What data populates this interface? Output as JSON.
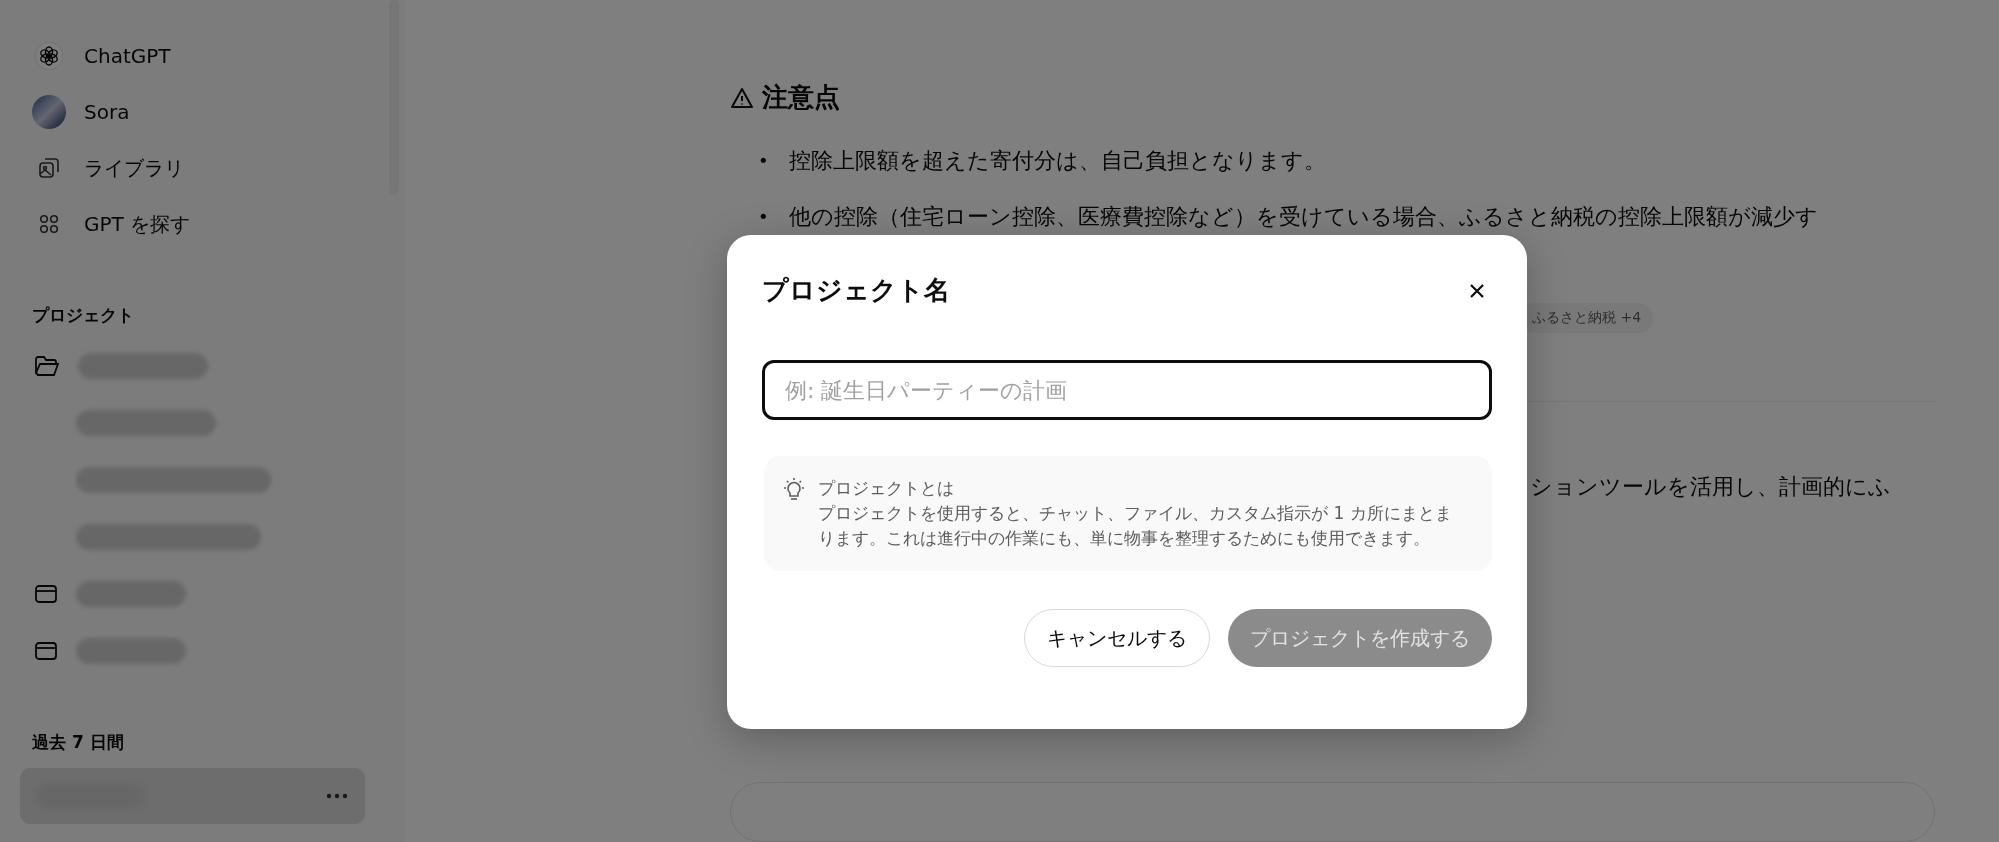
{
  "sidebar": {
    "nav": [
      {
        "label": "ChatGPT",
        "kind": "logo"
      },
      {
        "label": "Sora",
        "kind": "avatar"
      },
      {
        "label": "ライブラリ",
        "kind": "library"
      },
      {
        "label": "GPT を探す",
        "kind": "explore"
      }
    ],
    "projects_heading": "プロジェクト",
    "projects": [
      {
        "expanded": true,
        "children": [
          {
            "kind": "chat"
          },
          {
            "kind": "chat"
          },
          {
            "kind": "chat"
          }
        ]
      },
      {
        "expanded": false
      },
      {
        "expanded": false
      }
    ],
    "recent_heading": "過去 7 日間",
    "recent": [
      {
        "selected": true
      }
    ]
  },
  "main": {
    "heading": "注意点",
    "bullets": [
      {
        "marker": "•",
        "text": "控除上限額を超えた寄付分は、自己負担となります。"
      },
      {
        "marker": "•",
        "text": "他の控除（住宅ローン控除、医療費控除など）を受けている場合、ふるさと納税の控除上限額が減少す"
      }
    ],
    "tag": "ふるさと納税 +4",
    "fragment": "ションツールを活用し、計画的にふ"
  },
  "dialog": {
    "title": "プロジェクト名",
    "placeholder": "例: 誕生日パーティーの計画",
    "info_title": "プロジェクトとは",
    "info_text": "プロジェクトを使用すると、チャット、ファイル、カスタム指示が 1 カ所にまとまります。これは進行中の作業にも、単に物事を整理するためにも使用できます。",
    "buttons": [
      {
        "label": "キャンセルする",
        "kind": "secondary"
      },
      {
        "label": "プロジェクトを作成する",
        "kind": "primary",
        "disabled": true
      }
    ]
  }
}
